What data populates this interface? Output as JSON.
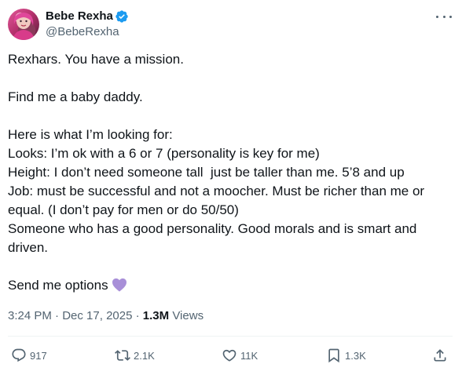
{
  "author": {
    "name": "Bebe Rexha",
    "handle": "@BebeRexha",
    "verified_color": "#1d9bf0"
  },
  "tweet": {
    "lines": [
      "Rexhars. You have a mission.",
      "",
      "Find me a baby daddy.",
      "",
      "Here is what I’m looking for:",
      "Looks: I’m ok with a 6 or 7 (personality is key for me)",
      "Height: I don’t need someone tall  just be taller than me. 5’8 and up",
      "Job: must be successful and not a moocher. Must be richer than me or",
      "equal. (I don’t pay for men or do 50/50)",
      "Someone who has a good personality. Good morals and is smart and",
      "driven.",
      "",
      "Send me options"
    ],
    "emoji": "purple-heart-icon",
    "emoji_color": "#a88fd8"
  },
  "meta": {
    "time": "3:24 PM",
    "separator": " · ",
    "date": "Dec 17, 2025",
    "views_count": "1.3M",
    "views_label": " Views"
  },
  "actions": {
    "replies": "917",
    "reposts": "2.1K",
    "likes": "11K",
    "bookmarks": "1.3K"
  },
  "icons": {
    "reply": "reply-icon",
    "repost": "repost-icon",
    "like": "heart-icon",
    "bookmark": "bookmark-icon",
    "share": "share-icon",
    "more": "more-icon"
  }
}
